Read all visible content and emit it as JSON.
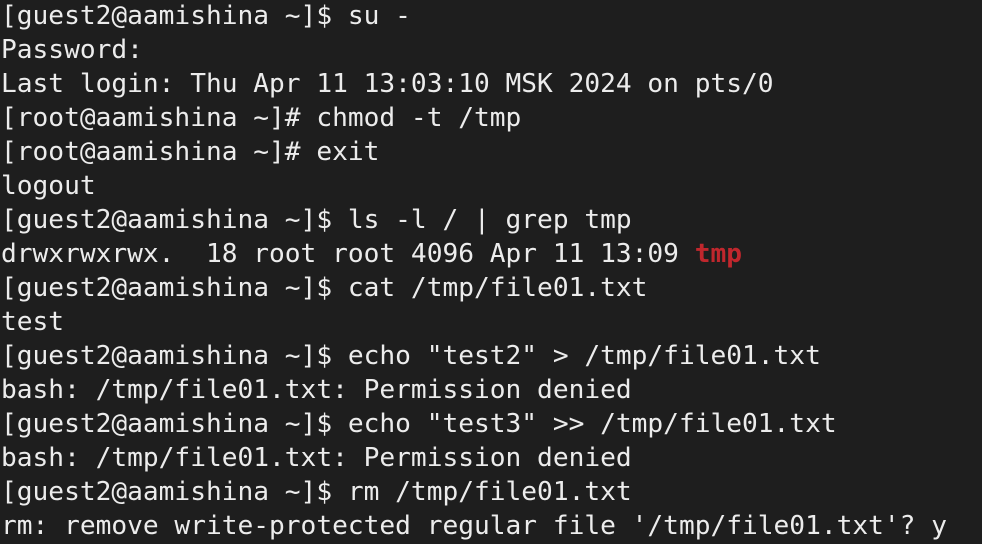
{
  "terminal": {
    "lines": [
      {
        "text": "[guest2@aamishina ~]$ su -"
      },
      {
        "text": "Password:"
      },
      {
        "text": "Last login: Thu Apr 11 13:03:10 MSK 2024 on pts/0"
      },
      {
        "text": "[root@aamishina ~]# chmod -t /tmp"
      },
      {
        "text": "[root@aamishina ~]# exit"
      },
      {
        "text": "logout"
      },
      {
        "text": "[guest2@aamishina ~]$ ls -l / | grep tmp"
      },
      {
        "text": "drwxrwxrwx.  18 root root 4096 Apr 11 13:09 ",
        "highlight": "tmp"
      },
      {
        "text": "[guest2@aamishina ~]$ cat /tmp/file01.txt"
      },
      {
        "text": "test"
      },
      {
        "text": "[guest2@aamishina ~]$ echo \"test2\" > /tmp/file01.txt"
      },
      {
        "text": "bash: /tmp/file01.txt: Permission denied"
      },
      {
        "text": "[guest2@aamishina ~]$ echo \"test3\" >> /tmp/file01.txt"
      },
      {
        "text": "bash: /tmp/file01.txt: Permission denied"
      },
      {
        "text": "[guest2@aamishina ~]$ rm /tmp/file01.txt"
      },
      {
        "text": "rm: remove write-protected regular file '/tmp/file01.txt'? y"
      }
    ]
  },
  "colors": {
    "background": "#1e1e1e",
    "foreground": "#ececec",
    "directory_highlight": "#c0272d"
  }
}
